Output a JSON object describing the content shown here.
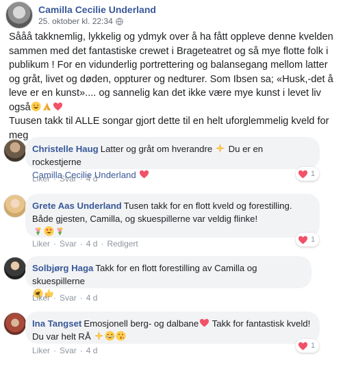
{
  "post": {
    "author": "Camilla Cecilie Underland",
    "timestamp": "25. oktober kl. 22:34",
    "privacy_icon": "globe-icon",
    "body_line1": "Sååå takknemlig, lykkelig og ydmyk over å ha fått oppleve denne kvelden sammen med det fantastiske crewet i Brageteatret og så mye flotte folk i publikum ! For en vidunderlig portrettering og balansegang mellom latter og gråt, livet og døden, oppturer og nedturer. Som Ibsen sa; «Husk,-det å leve er en kunst».... og sannelig kan det ikke være mye kunst i levet liv også",
    "body_line2": "Tuusen takk til ALLE songar gjort dette til en helt uforglemmelig kveld for meg"
  },
  "comments": [
    {
      "author": "Christelle Haug",
      "text_a": "Latter og gråt om hverandre",
      "text_b": "Du er en rockestjerne",
      "mention": "Camilla Cecilie Underland",
      "like": "Liker",
      "reply": "Svar",
      "age": "4 d",
      "reaction_count": "1"
    },
    {
      "author": "Grete Aas Underland",
      "text_a": "Tusen takk for en flott kveld og forestilling. Både gjesten, Camilla, og skuespillerne var veldig flinke!",
      "like": "Liker",
      "reply": "Svar",
      "age": "4 d",
      "edited": "Redigert",
      "reaction_count": "1"
    },
    {
      "author": "Solbjørg Haga",
      "text_a": "Takk for en flott forestilling av Camilla og skuespillerne",
      "like": "Liker",
      "reply": "Svar",
      "age": "4 d"
    },
    {
      "author": "Ina Tangset",
      "text_a": "Emosjonell berg- og dalbane",
      "text_b": "Takk for fantastisk kveld!",
      "text_c": "Du var helt RÅ",
      "like": "Liker",
      "reply": "Svar",
      "age": "4 d",
      "reaction_count": "1"
    }
  ],
  "colors": {
    "link": "#385898",
    "bubble": "#f2f3f5",
    "muted": "#8d949e",
    "heart": "#f33e58"
  }
}
